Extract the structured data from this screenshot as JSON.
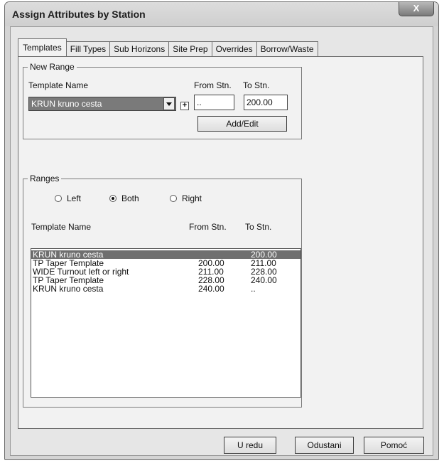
{
  "window": {
    "title": "Assign Attributes by Station",
    "close_label": "X"
  },
  "tabs": [
    {
      "label": "Templates",
      "active": true
    },
    {
      "label": "Fill Types"
    },
    {
      "label": "Sub Horizons"
    },
    {
      "label": "Site Prep"
    },
    {
      "label": "Overrides"
    },
    {
      "label": "Borrow/Waste"
    }
  ],
  "new_range": {
    "legend": "New Range",
    "template_name_label": "Template Name",
    "template_selected": "KRUN kruno cesta",
    "from_label": "From Stn.",
    "to_label": "To Stn.",
    "from_value": "..",
    "to_value": "200.00",
    "plus_label": "+",
    "add_edit_label": "Add/Edit"
  },
  "ranges": {
    "legend": "Ranges",
    "radio_left": "Left",
    "radio_both": "Both",
    "radio_right": "Right",
    "selected_radio": "Both",
    "headers": {
      "name": "Template Name",
      "from": "From Stn.",
      "to": "To Stn."
    },
    "rows": [
      {
        "name": "KRUN kruno cesta",
        "from": "",
        "to": "200.00"
      },
      {
        "name": "TP Taper Template",
        "from": "200.00",
        "to": "211.00"
      },
      {
        "name": "WIDE Turnout left or right",
        "from": "211.00",
        "to": "228.00"
      },
      {
        "name": "TP Taper Template",
        "from": "228.00",
        "to": "240.00"
      },
      {
        "name": "KRUN kruno cesta",
        "from": "240.00",
        "to": ".."
      }
    ]
  },
  "buttons": {
    "ok": "U redu",
    "cancel": "Odustani",
    "help": "Pomoć"
  }
}
